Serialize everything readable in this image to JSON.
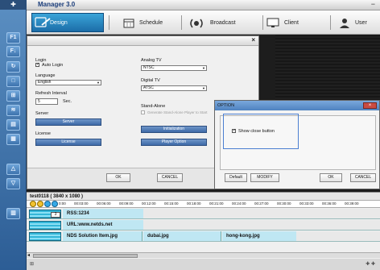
{
  "app": {
    "title": "Manager 3.0",
    "minimize_glyph": "−",
    "pin_glyph": "✚"
  },
  "nav": {
    "tabs": [
      {
        "label": "Design",
        "icon": "design-icon",
        "active": true
      },
      {
        "label": "Schedule",
        "icon": "calendar-icon"
      },
      {
        "label": "Broadcast",
        "icon": "broadcast-icon"
      },
      {
        "label": "Client",
        "icon": "monitor-icon"
      },
      {
        "label": "User",
        "icon": "user-icon"
      }
    ]
  },
  "sidebar": {
    "items": [
      {
        "label": "F1",
        "icon": "f1-icon"
      },
      {
        "label": "F↓",
        "icon": "font-icon"
      },
      {
        "label": "↻",
        "icon": "rotate-icon"
      },
      {
        "label": "□",
        "icon": "window-icon"
      },
      {
        "label": "⊞",
        "icon": "grid-icon"
      },
      {
        "label": "≋",
        "icon": "feed-icon"
      },
      {
        "label": "▤",
        "icon": "list-icon"
      },
      {
        "label": "▦",
        "icon": "table-icon"
      },
      {
        "label": "△",
        "icon": "triangle-icon"
      },
      {
        "label": "▽",
        "icon": "down-triangle-icon"
      },
      {
        "label": "▥",
        "icon": "layout-icon"
      }
    ]
  },
  "settings_dialog": {
    "close_glyph": "×",
    "login_label": "Login",
    "auto_login_label": "Auto Login",
    "auto_login_checked": true,
    "language_label": "Language",
    "language_value": "English",
    "refresh_label": "Refresh Interval",
    "refresh_value": "5",
    "refresh_unit": "Sec.",
    "server_label": "Server",
    "server_button": "Server",
    "license_label": "License",
    "license_button": "License",
    "analog_tv_label": "Analog TV",
    "analog_tv_value": "NTSC",
    "digital_tv_label": "Digital TV",
    "digital_tv_value": "ATSC",
    "standalone_label": "Stand-Alone",
    "standalone_option": "Generate Stand-Alone Player to Start",
    "initialization_button": "Initialization",
    "player_option_button": "Player Option",
    "ok_button": "OK",
    "cancel_button": "CANCEL"
  },
  "option_dialog": {
    "title": "OPTION",
    "close_glyph": "×",
    "show_close_label": "Show close button",
    "show_close_checked": true,
    "default_button": "Default",
    "modify_button": "MODIFY",
    "ok_button": "OK",
    "cancel_button": "CANCEL"
  },
  "timeline": {
    "title": "test0118 ( 3840 x 1080 )",
    "ticks": [
      "0:00",
      "00:03:00",
      "00:06:00",
      "00:09:00",
      "00:12:00",
      "00:15:00",
      "00:18:00",
      "00:21:00",
      "00:24:00",
      "00:27:00",
      "00:30:00",
      "00:33:00",
      "00:36:00",
      "00:39:00"
    ],
    "tracks": [
      {
        "pill": "3",
        "clips": [
          "RSS:1234"
        ]
      },
      {
        "pill": "",
        "clips": [
          "URL:www.netds.net"
        ]
      },
      {
        "pill": "",
        "clips": [
          "NDS Solution Item.jpg",
          "dubai.jpg",
          "hong-kong.jpg"
        ]
      }
    ],
    "scroll_left_glyph": "◂",
    "status_left": "⊞",
    "status_right": "✚ ✚"
  },
  "colors": {
    "accent": "#1c6da8",
    "sidebar": "#3d73ad",
    "track": "#bfe7f3"
  }
}
